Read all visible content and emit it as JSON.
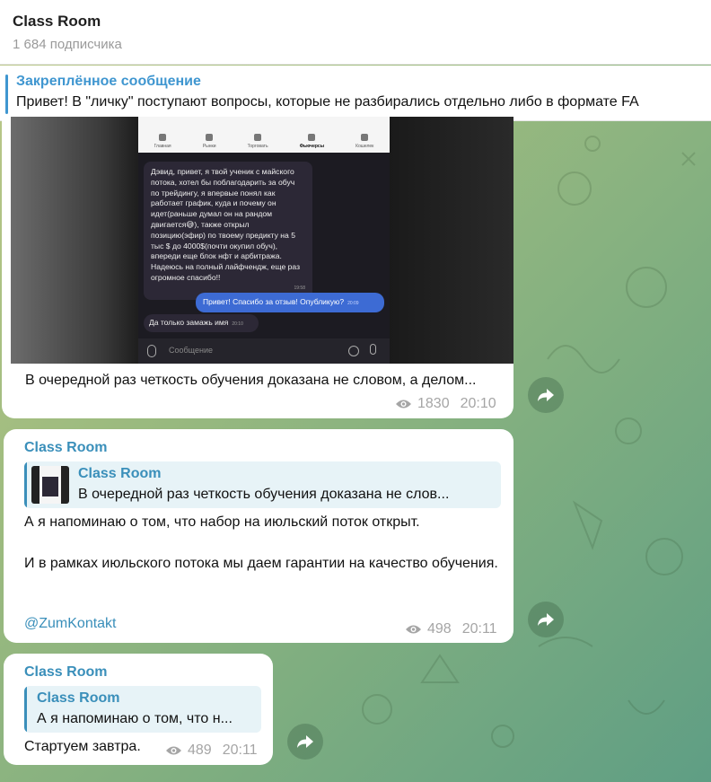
{
  "header": {
    "title": "Class Room",
    "subscribers": "1 684 подписчика"
  },
  "pinned": {
    "title": "Закреплённое сообщение",
    "text": "Привет!   В \"личку\" поступают вопросы, которые не разбирались отдельно либо в формате FA"
  },
  "colors": {
    "accent": "#3a8fba",
    "pinned_accent": "#3f96d0",
    "reply_blue": "#3d6bd4"
  },
  "messages": [
    {
      "photo": {
        "tabs": [
          "Главная",
          "Рынки",
          "Торговать",
          "Фьючерсы",
          "Кошелек"
        ],
        "active_tab": "Фьючерсы",
        "review_text": "Дэвид, привет, я твой ученик с майского потока, хотел бы поблагодарить за обуч по трейдингу, я впервые понял как работает график, куда и почему он идет(раньше думал он на рандом двигается😅), также открыл позицию(эфир) по твоему предикту на 5 тыс $ до 4000$(почти окупил обуч), впереди еще блок нфт и арбитража. Надеюсь на полный лайфчендж, еще раз огромное спасибо!!",
        "review_time": "19:58",
        "reply_text": "Привет! Спасибо за отзыв! Опубликую?",
        "reply_time": "20:09",
        "answer_text": "Да только замажь имя",
        "answer_time": "20:10",
        "input_placeholder": "Сообщение"
      },
      "text": "В очередной раз четкость обучения доказана не словом, а делом...",
      "views": "1830",
      "time": "20:10"
    },
    {
      "sender": "Class Room",
      "quote": {
        "name": "Class Room",
        "text": "В очередной раз четкость обучения доказана не слов..."
      },
      "line1": "А я напоминаю о том, что набор на июльский поток открыт.",
      "line2": "И в рамках июльского потока мы даем гарантии на качество обучения.",
      "link": "@ZumKontakt",
      "views": "498",
      "time": "20:11"
    },
    {
      "sender": "Class Room",
      "quote": {
        "name": "Class Room",
        "text": "А я напоминаю о том, что н..."
      },
      "text": "Стартуем завтра.",
      "views": "489",
      "time": "20:11"
    }
  ]
}
